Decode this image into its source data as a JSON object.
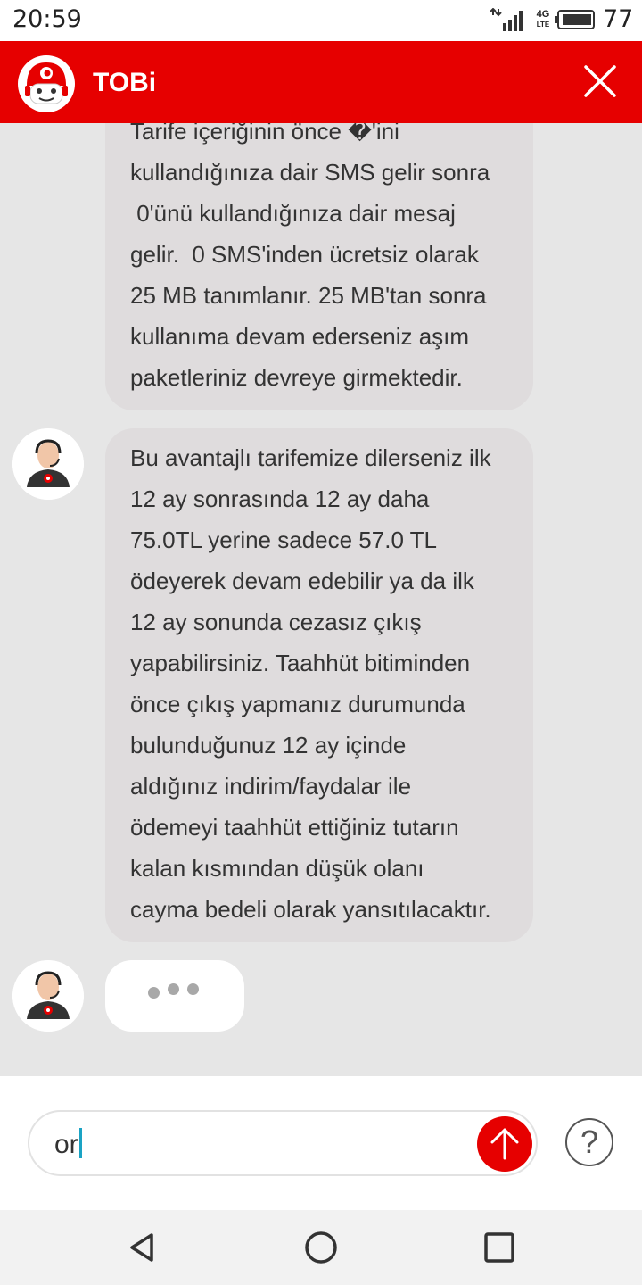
{
  "status_bar": {
    "time": "20:59",
    "network": "4G",
    "network_sub": "LTE",
    "battery": "77",
    "icons": [
      "signal-icon",
      "lte-icon",
      "battery-icon"
    ]
  },
  "header": {
    "title": "TOBi",
    "icons": [
      "tobi-avatar",
      "close-icon"
    ],
    "background": "#e60000"
  },
  "chat": {
    "messages": [
      {
        "sender": "agent",
        "lines": [
          "Tarife içeriğinin önce �'ini",
          "kullandığınıza dair SMS gelir sonra",
          " 0'ünü kullandığınıza dair mesaj",
          "gelir.  0 SMS'inden ücretsiz olarak",
          "25 MB tanımlanır. 25 MB'tan sonra",
          "kullanıma devam ederseniz aşım",
          "paketleriniz devreye girmektedir."
        ]
      },
      {
        "sender": "agent",
        "lines": [
          "Bu avantajlı tarifemize dilerseniz ilk",
          "12 ay sonrasında 12 ay daha",
          "75.0TL yerine sadece 57.0 TL",
          "ödeyerek devam edebilir ya da ilk",
          "12 ay sonunda cezasız çıkış",
          "yapabilirsiniz. Taahhüt bitiminden",
          "önce çıkış yapmanız durumunda",
          "bulunduğunuz 12 ay içinde",
          "aldığınız indirim/faydalar ile",
          "ödemeyi taahhüt ettiğiniz tutarın",
          "kalan kısmından düşük olanı",
          "cayma bedeli olarak yansıtılacaktır."
        ]
      }
    ],
    "typing_indicator": true
  },
  "input": {
    "value": "or",
    "send_icon": "arrow-up-icon",
    "help_label": "?"
  },
  "nav": {
    "icons": [
      "back-icon",
      "home-icon",
      "recents-icon"
    ]
  }
}
